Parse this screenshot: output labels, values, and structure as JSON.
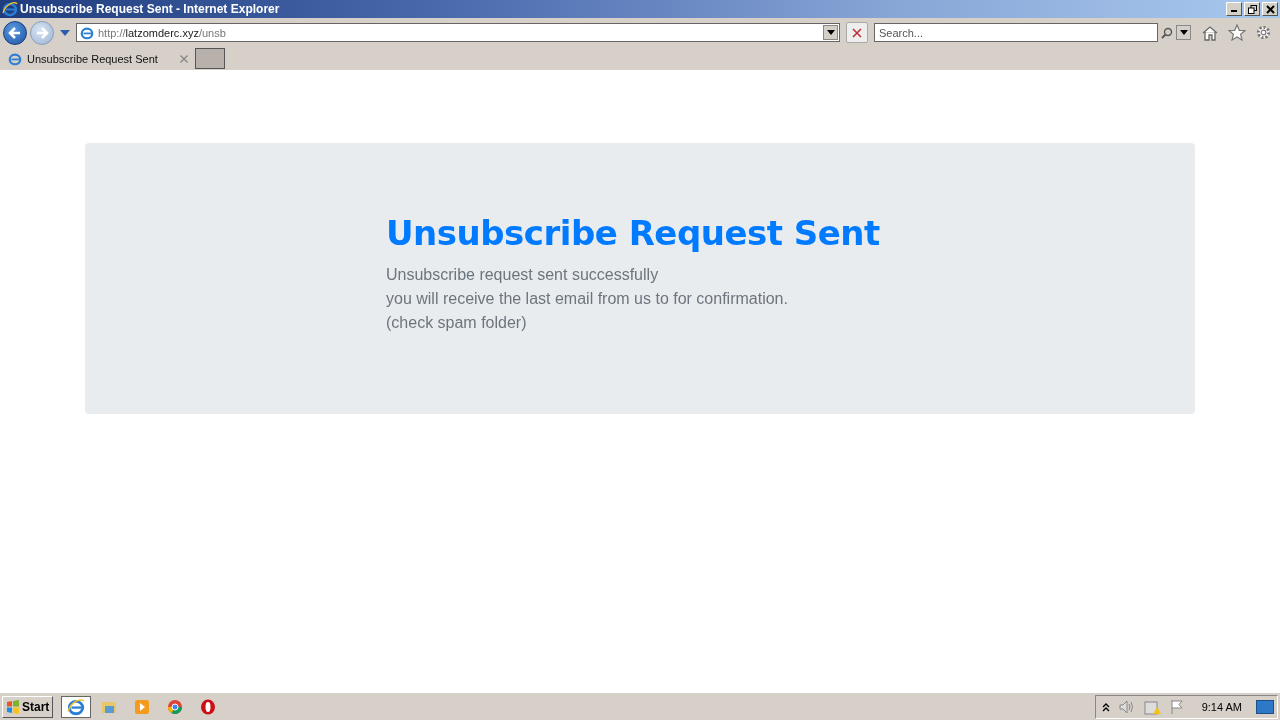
{
  "window": {
    "title": "Unsubscribe Request Sent - Internet Explorer"
  },
  "address": {
    "scheme": "http://",
    "host": "latzomderc.xyz",
    "path": "/unsb"
  },
  "search": {
    "placeholder": "Search..."
  },
  "tabs": [
    {
      "label": "Unsubscribe Request Sent",
      "selected": true
    }
  ],
  "page": {
    "heading": "Unsubscribe Request Sent",
    "lines": [
      "Unsubscribe request sent successfully",
      "you will receive the last email from us to for confirmation.",
      "(check spam folder)"
    ]
  },
  "taskbar": {
    "start": "Start",
    "apps": [
      {
        "kind": "ie",
        "selected": true
      },
      {
        "kind": "folder",
        "selected": false
      },
      {
        "kind": "media",
        "selected": false
      },
      {
        "kind": "chrome",
        "selected": false
      },
      {
        "kind": "opera",
        "selected": false
      }
    ],
    "clock": "9:14 AM"
  }
}
